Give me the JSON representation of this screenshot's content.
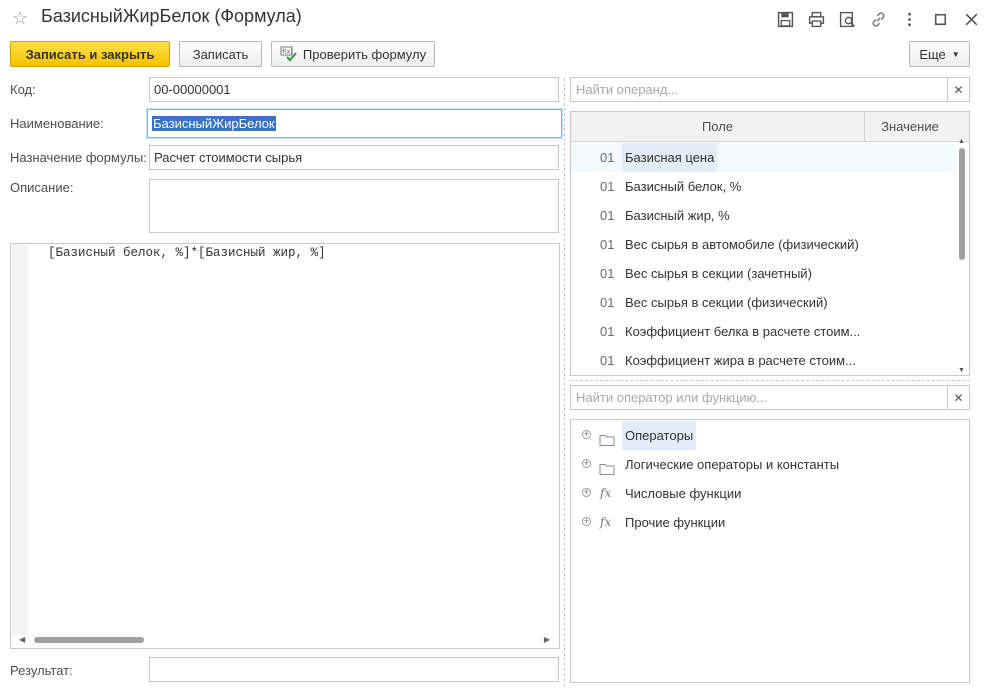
{
  "window": {
    "title": "БазисныйЖирБелок (Формула)"
  },
  "toolbar": {
    "save_close": "Записать и закрыть",
    "save": "Записать",
    "check_formula": "Проверить формулу",
    "more": "Еще"
  },
  "form": {
    "code_label": "Код:",
    "code_value": "00-00000001",
    "name_label": "Наименование:",
    "name_value": "БазисныйЖирБелок",
    "purpose_label": "Назначение формулы:",
    "purpose_value": "Расчет стоимости сырья",
    "description_label": "Описание:",
    "description_value": "",
    "formula_text": "[Базисный белок, %]*[Базисный жир, %]",
    "result_label": "Результат:",
    "result_value": ""
  },
  "operands": {
    "search_placeholder": "Найти операнд...",
    "columns": [
      "Поле",
      "Значение"
    ],
    "rows": [
      {
        "code": "01",
        "name": "Базисная цена"
      },
      {
        "code": "01",
        "name": "Базисный белок, %"
      },
      {
        "code": "01",
        "name": "Базисный жир, %"
      },
      {
        "code": "01",
        "name": "Вес сырья в автомобиле (физический)"
      },
      {
        "code": "01",
        "name": "Вес сырья в секции (зачетный)"
      },
      {
        "code": "01",
        "name": "Вес сырья в секции (физический)"
      },
      {
        "code": "01",
        "name": "Коэффициент белка в расчете стоим..."
      },
      {
        "code": "01",
        "name": "Коэффициент жира в расчете стоим..."
      }
    ],
    "selected_index": 0
  },
  "functions": {
    "search_placeholder": "Найти оператор или функцию...",
    "items": [
      {
        "icon": "folder-icon",
        "label": "Операторы"
      },
      {
        "icon": "folder-icon",
        "label": "Логические операторы и константы"
      },
      {
        "icon": "fx-icon",
        "label": "Числовые функции",
        "glyph": "fx"
      },
      {
        "icon": "fx-icon",
        "label": "Прочие функции",
        "glyph": "fx"
      }
    ],
    "selected_index": 0
  },
  "icons": {
    "favorite": "star-icon",
    "save_file": "save-icon",
    "print": "print-icon",
    "preview": "preview-icon",
    "link": "link-icon",
    "menu": "more-vertical-icon",
    "maximize": "maximize-icon",
    "close": "close-icon"
  },
  "colors": {
    "primary_button": "#f2c100",
    "selection": "#3973c9",
    "row_highlight": "#e1eefa"
  }
}
